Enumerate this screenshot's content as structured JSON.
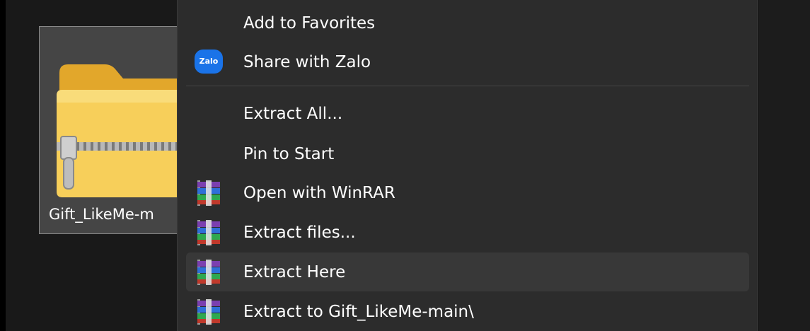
{
  "file": {
    "name": "Gift_LikeMe-m"
  },
  "context_menu": {
    "items": [
      {
        "label": "Add to Favorites",
        "icon": "none"
      },
      {
        "label": "Share with Zalo",
        "icon": "zalo-icon",
        "icon_text": "Zalo"
      },
      {
        "label": "Extract All...",
        "icon": "none"
      },
      {
        "label": "Pin to Start",
        "icon": "none"
      },
      {
        "label": "Open with WinRAR",
        "icon": "winrar-icon"
      },
      {
        "label": "Extract files...",
        "icon": "winrar-icon"
      },
      {
        "label": "Extract Here",
        "icon": "winrar-icon",
        "state": "hovered"
      },
      {
        "label": "Extract to Gift_LikeMe-main\\",
        "icon": "winrar-icon"
      }
    ]
  },
  "colors": {
    "desktop_background": "#191919",
    "menu_background": "#2c2c2c",
    "hover_background": "#383838",
    "text": "#ffffff",
    "zalo_blue": "#1a73e8",
    "folder_yellow": "#f6c94c"
  }
}
